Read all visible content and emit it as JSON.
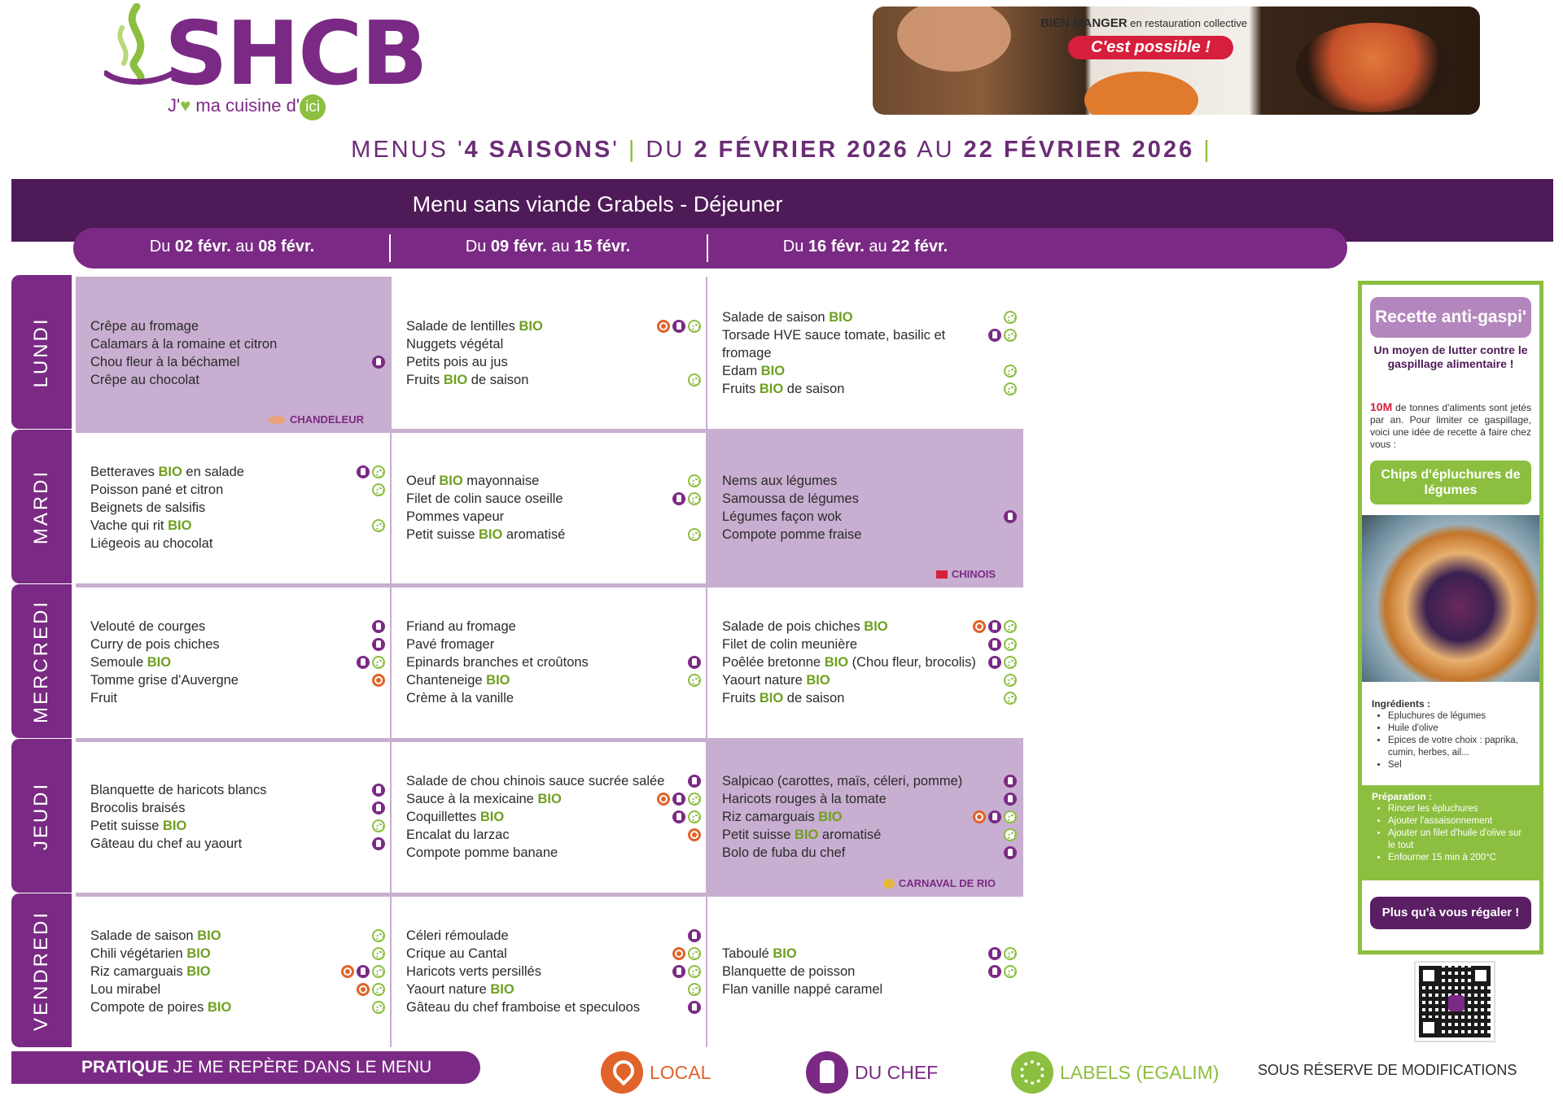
{
  "header": {
    "logo_text": "SHCB",
    "logo_tagline_pre": "J'",
    "logo_tagline_mid": " ma cuisine d'",
    "logo_tagline_ici": "ici",
    "banner_line1_bold": "BIEN MANGER",
    "banner_line1_rest": " en restauration collective",
    "banner_line2": "C'est possible !"
  },
  "title": {
    "p1": "MENUS '",
    "p2": "4 SAISONS",
    "p3": "' ",
    "p4": " DU ",
    "p5": "2 FÉVRIER 2026",
    "p6": " AU ",
    "p7": "22 FÉVRIER 2026",
    "sep": "|"
  },
  "menu_title": "Menu sans viande Grabels - Déjeuner",
  "weeks": [
    {
      "pre": "Du ",
      "d1": "02 févr.",
      "mid": " au ",
      "d2": "08 févr."
    },
    {
      "pre": "Du ",
      "d1": "09 févr.",
      "mid": " au ",
      "d2": "15 févr."
    },
    {
      "pre": "Du ",
      "d1": "16 févr.",
      "mid": " au ",
      "d2": "22 févr."
    }
  ],
  "days": [
    "LUNDI",
    "MARDI",
    "MERCREDI",
    "JEUDI",
    "VENDREDI"
  ],
  "colors": {
    "purple": "#7a2a84",
    "dark_purple": "#4e1a57",
    "highlight": "#c8aed0",
    "green": "#8cbf3f",
    "bio_green": "#6f9f1f",
    "orange": "#e0632a"
  },
  "cells": [
    [
      {
        "highlight": true,
        "theme": "CHANDELEUR",
        "items": [
          {
            "t": "Crêpe au fromage",
            "b": []
          },
          {
            "t": "Calamars à la romaine et citron",
            "b": []
          },
          {
            "t": "Chou fleur à la béchamel",
            "b": [
              "chef"
            ]
          },
          {
            "t": "Crêpe au chocolat",
            "b": []
          }
        ]
      },
      {
        "highlight": false,
        "items": [
          {
            "t": "Salade de lentilles ",
            "bio": "BIO",
            "b": [
              "local",
              "chef",
              "label"
            ]
          },
          {
            "t": "Nuggets végétal",
            "b": []
          },
          {
            "t": "Petits pois au jus",
            "b": []
          },
          {
            "t": "Fruits ",
            "bio": "BIO",
            "t2": " de saison",
            "b": [
              "label"
            ]
          }
        ]
      },
      {
        "highlight": false,
        "items": [
          {
            "t": "Salade de saison ",
            "bio": "BIO",
            "b": [
              "label"
            ]
          },
          {
            "t": "Torsade HVE sauce tomate, basilic et fromage",
            "b": [
              "chef",
              "label"
            ]
          },
          {
            "t": "Edam ",
            "bio": "BIO",
            "b": [
              "label"
            ]
          },
          {
            "t": "Fruits ",
            "bio": "BIO",
            "t2": " de saison",
            "b": [
              "label"
            ]
          }
        ]
      }
    ],
    [
      {
        "highlight": false,
        "items": [
          {
            "t": "Betteraves ",
            "bio": "BIO",
            "t2": " en salade",
            "b": [
              "chef",
              "label"
            ]
          },
          {
            "t": "Poisson pané et citron",
            "b": [
              "label"
            ]
          },
          {
            "t": "Beignets de salsifis",
            "b": []
          },
          {
            "t": "Vache qui rit ",
            "bio": "BIO",
            "b": [
              "label"
            ]
          },
          {
            "t": "Liégeois au chocolat",
            "b": []
          }
        ]
      },
      {
        "highlight": false,
        "items": [
          {
            "t": "Oeuf ",
            "bio": "BIO",
            "t2": " mayonnaise",
            "b": [
              "label"
            ]
          },
          {
            "t": "Filet de colin sauce oseille",
            "b": [
              "chef",
              "label"
            ]
          },
          {
            "t": "Pommes vapeur",
            "b": []
          },
          {
            "t": "Petit suisse ",
            "bio": "BIO",
            "t2": " aromatisé",
            "b": [
              "label"
            ]
          }
        ]
      },
      {
        "highlight": true,
        "theme": "CHINOIS",
        "items": [
          {
            "t": "Nems aux légumes",
            "b": []
          },
          {
            "t": "Samoussa de légumes",
            "b": []
          },
          {
            "t": "Légumes façon wok",
            "b": [
              "chef"
            ]
          },
          {
            "t": "Compote pomme fraise",
            "b": []
          }
        ]
      }
    ],
    [
      {
        "highlight": false,
        "items": [
          {
            "t": "Velouté de courges",
            "b": [
              "chef"
            ]
          },
          {
            "t": "Curry de pois chiches",
            "b": [
              "chef"
            ]
          },
          {
            "t": "Semoule ",
            "bio": "BIO",
            "b": [
              "chef",
              "label"
            ]
          },
          {
            "t": "Tomme grise d'Auvergne",
            "b": [
              "local"
            ]
          },
          {
            "t": "Fruit",
            "b": []
          }
        ]
      },
      {
        "highlight": false,
        "items": [
          {
            "t": "Friand au fromage",
            "b": []
          },
          {
            "t": "Pavé fromager",
            "b": []
          },
          {
            "t": "Epinards branches et croûtons",
            "b": [
              "chef"
            ]
          },
          {
            "t": "Chanteneige ",
            "bio": "BIO",
            "b": [
              "label"
            ]
          },
          {
            "t": "Crème à la vanille",
            "b": []
          }
        ]
      },
      {
        "highlight": false,
        "items": [
          {
            "t": "Salade de pois chiches ",
            "bio": "BIO",
            "b": [
              "local",
              "chef",
              "label"
            ]
          },
          {
            "t": "Filet de colin meunière",
            "b": [
              "chef",
              "label"
            ]
          },
          {
            "t": "Poêlée bretonne ",
            "bio": "BIO",
            "t2": " (Chou fleur, brocolis)",
            "b": [
              "chef",
              "label"
            ]
          },
          {
            "t": "Yaourt nature ",
            "bio": "BIO",
            "b": [
              "label"
            ]
          },
          {
            "t": "Fruits ",
            "bio": "BIO",
            "t2": " de saison",
            "b": [
              "label"
            ]
          }
        ]
      }
    ],
    [
      {
        "highlight": false,
        "items": [
          {
            "t": "Blanquette de haricots blancs",
            "b": [
              "chef"
            ]
          },
          {
            "t": "Brocolis braisés",
            "b": [
              "chef"
            ]
          },
          {
            "t": "Petit suisse ",
            "bio": "BIO",
            "b": [
              "label"
            ]
          },
          {
            "t": "Gâteau du chef au yaourt",
            "b": [
              "chef"
            ]
          }
        ]
      },
      {
        "highlight": false,
        "items": [
          {
            "t": "Salade de chou chinois sauce sucrée salée",
            "b": [
              "chef"
            ]
          },
          {
            "t": "Sauce à la mexicaine ",
            "bio": "BIO",
            "b": [
              "local",
              "chef",
              "label"
            ]
          },
          {
            "t": "Coquillettes ",
            "bio": "BIO",
            "b": [
              "chef",
              "label"
            ]
          },
          {
            "t": "Encalat du larzac",
            "b": [
              "local"
            ]
          },
          {
            "t": "Compote pomme banane",
            "b": []
          }
        ]
      },
      {
        "highlight": true,
        "theme": "CARNAVAL DE RIO",
        "items": [
          {
            "t": "Salpicao (carottes, maïs, céleri, pomme)",
            "b": [
              "chef"
            ]
          },
          {
            "t": "Haricots rouges à la tomate",
            "b": [
              "chef"
            ]
          },
          {
            "t": "Riz camarguais ",
            "bio": "BIO",
            "b": [
              "local",
              "chef",
              "label"
            ]
          },
          {
            "t": "Petit suisse ",
            "bio": "BIO",
            "t2": " aromatisé",
            "b": [
              "label"
            ]
          },
          {
            "t": "Bolo de fuba du chef",
            "b": [
              "chef"
            ]
          }
        ]
      }
    ],
    [
      {
        "highlight": false,
        "items": [
          {
            "t": "Salade de saison ",
            "bio": "BIO",
            "b": [
              "label"
            ]
          },
          {
            "t": "Chili végétarien ",
            "bio": "BIO",
            "b": [
              "label"
            ]
          },
          {
            "t": "Riz camarguais ",
            "bio": "BIO",
            "b": [
              "local",
              "chef",
              "label"
            ]
          },
          {
            "t": "Lou mirabel",
            "b": [
              "local",
              "label"
            ]
          },
          {
            "t": "Compote de poires ",
            "bio": "BIO",
            "b": [
              "label"
            ]
          }
        ]
      },
      {
        "highlight": false,
        "items": [
          {
            "t": "Céleri rémoulade",
            "b": [
              "chef"
            ]
          },
          {
            "t": "Crique au Cantal",
            "b": [
              "local",
              "label"
            ]
          },
          {
            "t": "Haricots verts persillés",
            "b": [
              "chef",
              "label"
            ]
          },
          {
            "t": "Yaourt nature ",
            "bio": "BIO",
            "b": [
              "label"
            ]
          },
          {
            "t": "Gâteau du chef framboise et speculoos",
            "b": [
              "chef"
            ]
          }
        ]
      },
      {
        "highlight": false,
        "items": [
          {
            "t": "Taboulé ",
            "bio": "BIO",
            "b": [
              "chef",
              "label"
            ]
          },
          {
            "t": "Blanquette de poisson",
            "b": [
              "chef",
              "label"
            ]
          },
          {
            "t": "Flan vanille nappé caramel",
            "b": []
          }
        ]
      }
    ]
  ],
  "anti_gaspi": {
    "title": "Recette anti-gaspi'",
    "subtitle": "Un moyen de lutter contre le gaspillage alimentaire !",
    "stat": "10M",
    "text": " de tonnes d'aliments sont jetés par an. Pour limiter ce gaspillage, voici une idée de recette à faire chez vous :",
    "recipe": "Chips d'épluchures de légumes",
    "ingredients_title": "Ingrédients :",
    "ingredients": [
      "Epluchures de légumes",
      "Huile d'olive",
      "Epices de votre choix : paprika, cumin, herbes, ail...",
      "Sel"
    ],
    "preparation_title": "Préparation :",
    "preparation": [
      "Rincer les épluchures",
      "Ajouter l'assaisonnement",
      "Ajouter un filet d'huile d'olive sur le tout",
      "Enfourner 15 min à 200°C"
    ],
    "closing": "Plus qu'à vous régaler !"
  },
  "footer": {
    "pratique_bold": "PRATIQUE",
    "pratique_rest": " JE ME REPÈRE DANS LE MENU",
    "legend_local": "LOCAL",
    "legend_chef": "DU CHEF",
    "legend_labels": "LABELS (EGALIM)",
    "reserve": "SOUS RÉSERVE DE MODIFICATIONS"
  }
}
